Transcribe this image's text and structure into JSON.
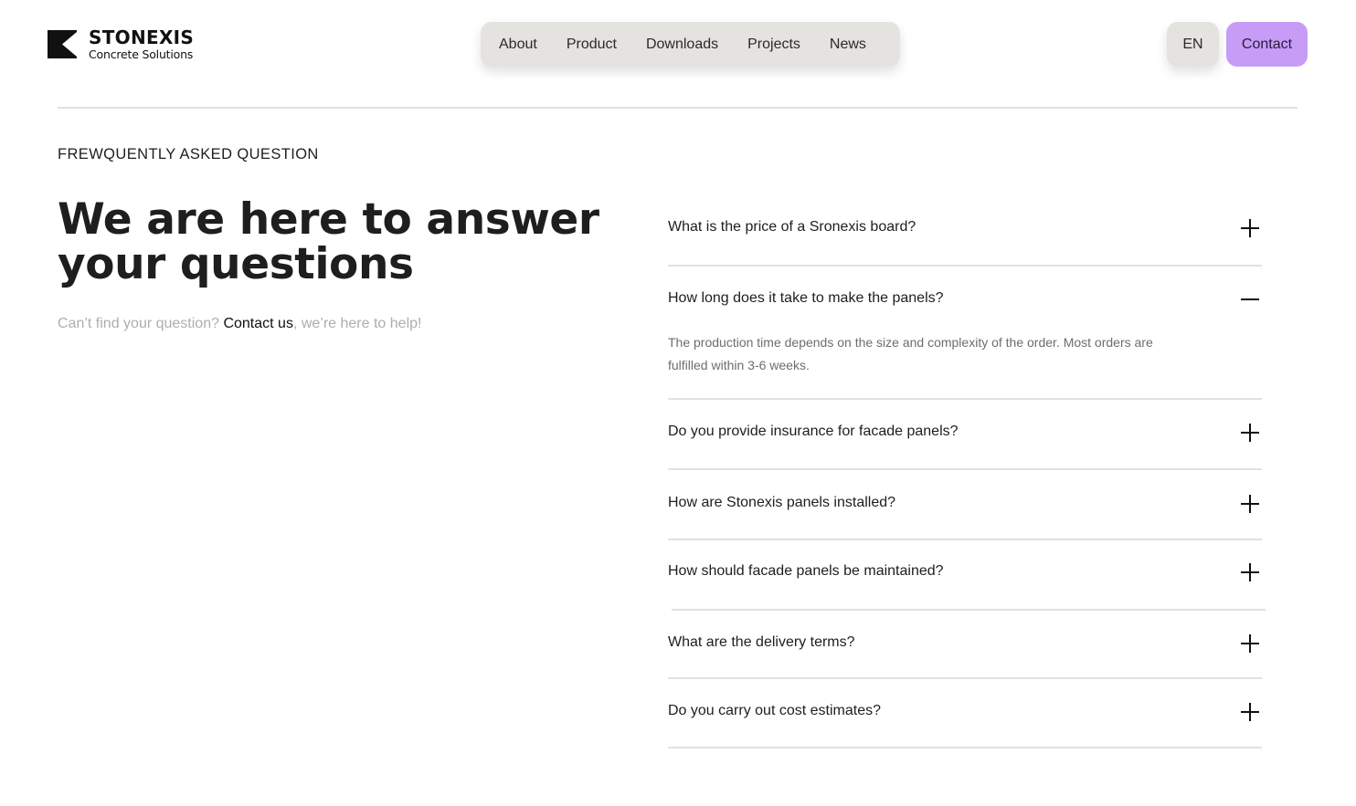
{
  "brand": {
    "name": "STONEXIS",
    "tagline": "Concrete Solutions",
    "logo_icon": "stonexis-logo-icon"
  },
  "nav": {
    "items": [
      {
        "label": "About"
      },
      {
        "label": "Product"
      },
      {
        "label": "Downloads"
      },
      {
        "label": "Projects"
      },
      {
        "label": "News"
      }
    ],
    "language": "EN",
    "contact_label": "Contact"
  },
  "intro": {
    "eyebrow": "FREWQUENTLY ASKED QUESTION",
    "headline": "We are here to answer your questions",
    "help_prefix": "Can’t find your question? ",
    "help_link": "Contact us",
    "help_suffix": ", we’re here to help!"
  },
  "faq": {
    "items": [
      {
        "question": "What is the price of a Sronexis board?",
        "expanded": false,
        "toggle_icon": "plus-icon"
      },
      {
        "question": "How long does it take to make the panels?",
        "expanded": true,
        "toggle_icon": "minus-icon",
        "answer": "The production time depends on the size and complexity of the order. Most orders are fulfilled within 3-6 weeks."
      },
      {
        "question": "Do you provide insurance for facade panels?",
        "expanded": false,
        "toggle_icon": "plus-icon"
      },
      {
        "question": "How are Stonexis panels installed?",
        "expanded": false,
        "toggle_icon": "plus-icon"
      },
      {
        "question": "How should facade panels be maintained?",
        "expanded": false,
        "toggle_icon": "plus-icon"
      },
      {
        "question": "What are the delivery terms?",
        "expanded": false,
        "toggle_icon": "plus-icon"
      },
      {
        "question": "Do you carry out cost estimates?",
        "expanded": false,
        "toggle_icon": "plus-icon"
      }
    ]
  },
  "colors": {
    "accent": "#c79cf7",
    "nav_bg": "#e4e3df",
    "rule": "#e2e1dc",
    "muted_text": "#aeaeae"
  }
}
